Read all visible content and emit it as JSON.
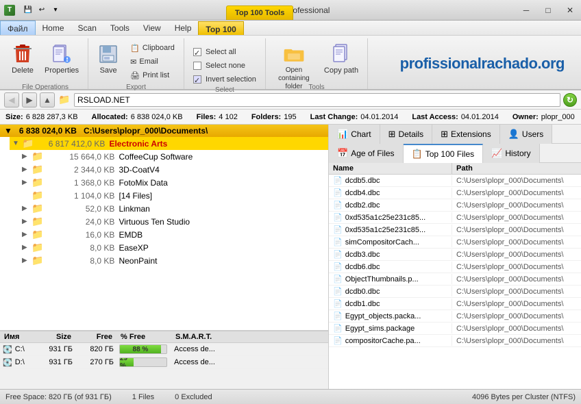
{
  "titlebar": {
    "title": "TreeSize Professional",
    "top100tab": "Top 100 Tools"
  },
  "menubar": {
    "items": [
      "Файл",
      "Home",
      "Scan",
      "Tools",
      "View",
      "Help",
      "Top 100"
    ]
  },
  "ribbon": {
    "groups": [
      {
        "label": "File Operations",
        "buttons": [
          {
            "id": "delete",
            "label": "Delete",
            "icon": "✖"
          },
          {
            "id": "properties",
            "label": "Properties",
            "icon": "🔧"
          }
        ]
      },
      {
        "label": "Export",
        "buttons": [
          {
            "id": "save",
            "label": "Save",
            "icon": "💾"
          }
        ],
        "small_buttons": [
          {
            "id": "clipboard",
            "label": "Clipboard",
            "icon": "📋"
          },
          {
            "id": "email",
            "label": "Email",
            "icon": "✉"
          },
          {
            "id": "print-list",
            "label": "Print list",
            "icon": "🖨"
          }
        ]
      },
      {
        "label": "Select",
        "small_buttons": [
          {
            "id": "select-all",
            "label": "Select all"
          },
          {
            "id": "select-none",
            "label": "Select none"
          },
          {
            "id": "invert-selection",
            "label": "Invert selection"
          }
        ]
      },
      {
        "label": "Tools",
        "buttons": [
          {
            "id": "open-folder",
            "label": "Open containing folder",
            "icon": "📂"
          },
          {
            "id": "copy-path",
            "label": "Copy path",
            "icon": "📄"
          }
        ]
      }
    ],
    "logo_text": "profissionalrachado.org"
  },
  "addressbar": {
    "path": "RSLOAD.NET",
    "size_label": "Size:",
    "size_value": "6 828 287,3 KB",
    "allocated_label": "Allocated:",
    "allocated_value": "6 838 024,0 KB",
    "files_label": "Files:",
    "files_value": "4 102",
    "folders_label": "Folders:",
    "folders_value": "195",
    "last_change_label": "Last Change:",
    "last_change_value": "04.01.2014",
    "last_access_label": "Last Access:",
    "last_access_value": "04.01.2014",
    "owner_label": "Owner:",
    "owner_value": "plopr_000"
  },
  "tree": {
    "header_size": "6 838 024,0 KB",
    "header_path": "C:\\Users\\plopr_000\\Documents\\",
    "rows": [
      {
        "size": "6 817 412,0 KB",
        "name": "Electronic Arts",
        "level": 1,
        "selected": true,
        "bold": true
      },
      {
        "size": "15 664,0 KB",
        "name": "CoffeeCup Software",
        "level": 2
      },
      {
        "size": "2 344,0 KB",
        "name": "3D-CoatV4",
        "level": 2
      },
      {
        "size": "1 368,0 KB",
        "name": "FotoMix Data",
        "level": 2
      },
      {
        "size": "1 104,0 KB",
        "name": "[14 Files]",
        "level": 2
      },
      {
        "size": "52,0 KB",
        "name": "Linkman",
        "level": 2
      },
      {
        "size": "24,0 KB",
        "name": "Virtuous Ten Studio",
        "level": 2
      },
      {
        "size": "16,0 KB",
        "name": "EMDB",
        "level": 2
      },
      {
        "size": "8,0 KB",
        "name": "EaseXP",
        "level": 2
      },
      {
        "size": "8,0 KB",
        "name": "NeonPaint",
        "level": 2
      }
    ]
  },
  "drives": {
    "headers": [
      "",
      "Size",
      "Free",
      "% Free",
      "S.M.A.R.T."
    ],
    "rows": [
      {
        "name": "C:\\",
        "size": "931 ГБ",
        "free": "820 ГБ",
        "pct": "88 %",
        "pct_val": 88,
        "smart": "Access de..."
      },
      {
        "name": "D:\\",
        "size": "931 ГБ",
        "free": "270 ГБ",
        "pct": "29 %",
        "pct_val": 29,
        "smart": "Access de..."
      }
    ]
  },
  "right_tabs_top": {
    "items": [
      {
        "id": "chart",
        "label": "Chart",
        "icon": "📊",
        "active": false
      },
      {
        "id": "details",
        "label": "Details",
        "icon": "⊞",
        "active": false
      },
      {
        "id": "extensions",
        "label": "Extensions",
        "icon": "⊞",
        "active": false
      },
      {
        "id": "users",
        "label": "Users",
        "icon": "👤",
        "active": false
      }
    ]
  },
  "right_tabs_bottom": {
    "items": [
      {
        "id": "age-of-files",
        "label": "Age of Files",
        "icon": "📅",
        "active": false
      },
      {
        "id": "top-100-files",
        "label": "Top 100 Files",
        "icon": "📋",
        "active": true
      },
      {
        "id": "history",
        "label": "History",
        "icon": "📈",
        "active": false
      }
    ]
  },
  "file_list": {
    "headers": [
      "Name",
      "Path"
    ],
    "files": [
      {
        "name": "dcdb5.dbc",
        "path": "C:\\Users\\plopr_000\\Documents\\"
      },
      {
        "name": "dcdb4.dbc",
        "path": "C:\\Users\\plopr_000\\Documents\\"
      },
      {
        "name": "dcdb2.dbc",
        "path": "C:\\Users\\plopr_000\\Documents\\"
      },
      {
        "name": "0xd535a1c25e231c85...",
        "path": "C:\\Users\\plopr_000\\Documents\\"
      },
      {
        "name": "0xd535a1c25e231c85...",
        "path": "C:\\Users\\plopr_000\\Documents\\"
      },
      {
        "name": "simCompositorCach...",
        "path": "C:\\Users\\plopr_000\\Documents\\"
      },
      {
        "name": "dcdb3.dbc",
        "path": "C:\\Users\\plopr_000\\Documents\\"
      },
      {
        "name": "dcdb6.dbc",
        "path": "C:\\Users\\plopr_000\\Documents\\"
      },
      {
        "name": "ObjectThumbnails.p...",
        "path": "C:\\Users\\plopr_000\\Documents\\"
      },
      {
        "name": "dcdb0.dbc",
        "path": "C:\\Users\\plopr_000\\Documents\\"
      },
      {
        "name": "dcdb1.dbc",
        "path": "C:\\Users\\plopr_000\\Documents\\"
      },
      {
        "name": "Egypt_objects.packa...",
        "path": "C:\\Users\\plopr_000\\Documents\\"
      },
      {
        "name": "Egypt_sims.package",
        "path": "C:\\Users\\plopr_000\\Documents\\"
      },
      {
        "name": "compositorCache.pa...",
        "path": "C:\\Users\\plopr_000\\Documents\\"
      }
    ]
  },
  "statusbar": {
    "free_space": "Free Space: 820 ГБ (of 931 ГБ)",
    "files": "1 Files",
    "excluded": "0 Excluded",
    "cluster": "4096 Bytes per Cluster (NTFS)"
  }
}
